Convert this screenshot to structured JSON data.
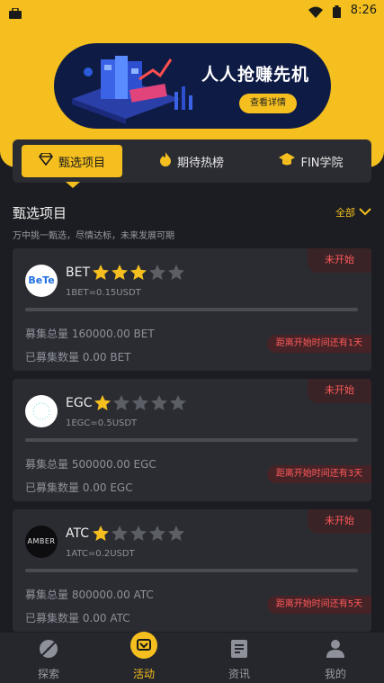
{
  "status_bar": {
    "time": "8:26"
  },
  "banner": {
    "title": "人人抢赚先机",
    "button_label": "查看详情"
  },
  "tabs": [
    {
      "label": "甄选项目",
      "active": true
    },
    {
      "label": "期待热榜",
      "active": false
    },
    {
      "label": "FIN学院",
      "active": false
    }
  ],
  "section": {
    "title": "甄选项目",
    "subtitle": "万中挑一甄选，尽情达标，未来发展可期",
    "filter_label": "全部"
  },
  "cards": [
    {
      "name": "BET",
      "logo_text": "BeTe",
      "rating": 3,
      "rate": "1BET=0.15USDT",
      "status": "未开始",
      "total": "募集总量 160000.00 BET",
      "raised": "已募集数量 0.00 BET",
      "progress": 0,
      "countdown": "距离开始时间还有1天"
    },
    {
      "name": "EGC",
      "logo_text": "",
      "rating": 1,
      "rate": "1EGC=0.5USDT",
      "status": "未开始",
      "total": "募集总量 500000.00 EGC",
      "raised": "已募集数量 0.00 EGC",
      "progress": 0,
      "countdown": "距离开始时间还有3天"
    },
    {
      "name": "ATC",
      "logo_text": "AMBER",
      "rating": 1,
      "rate": "1ATC=0.2USDT",
      "status": "未开始",
      "total": "募集总量 800000.00 ATC",
      "raised": "已募集数量 0.00 ATC",
      "progress": 0,
      "countdown": "距离开始时间还有5天"
    }
  ],
  "nav": [
    {
      "label": "探索",
      "icon": "explore-icon",
      "active": false
    },
    {
      "label": "活动",
      "icon": "activity-icon",
      "active": true
    },
    {
      "label": "资讯",
      "icon": "news-icon",
      "active": false
    },
    {
      "label": "我的",
      "icon": "profile-icon",
      "active": false
    }
  ],
  "colors": {
    "accent": "#f4bf1f",
    "background": "#1c1d22",
    "card": "#2b2c32",
    "alert": "#ff5a5a"
  }
}
